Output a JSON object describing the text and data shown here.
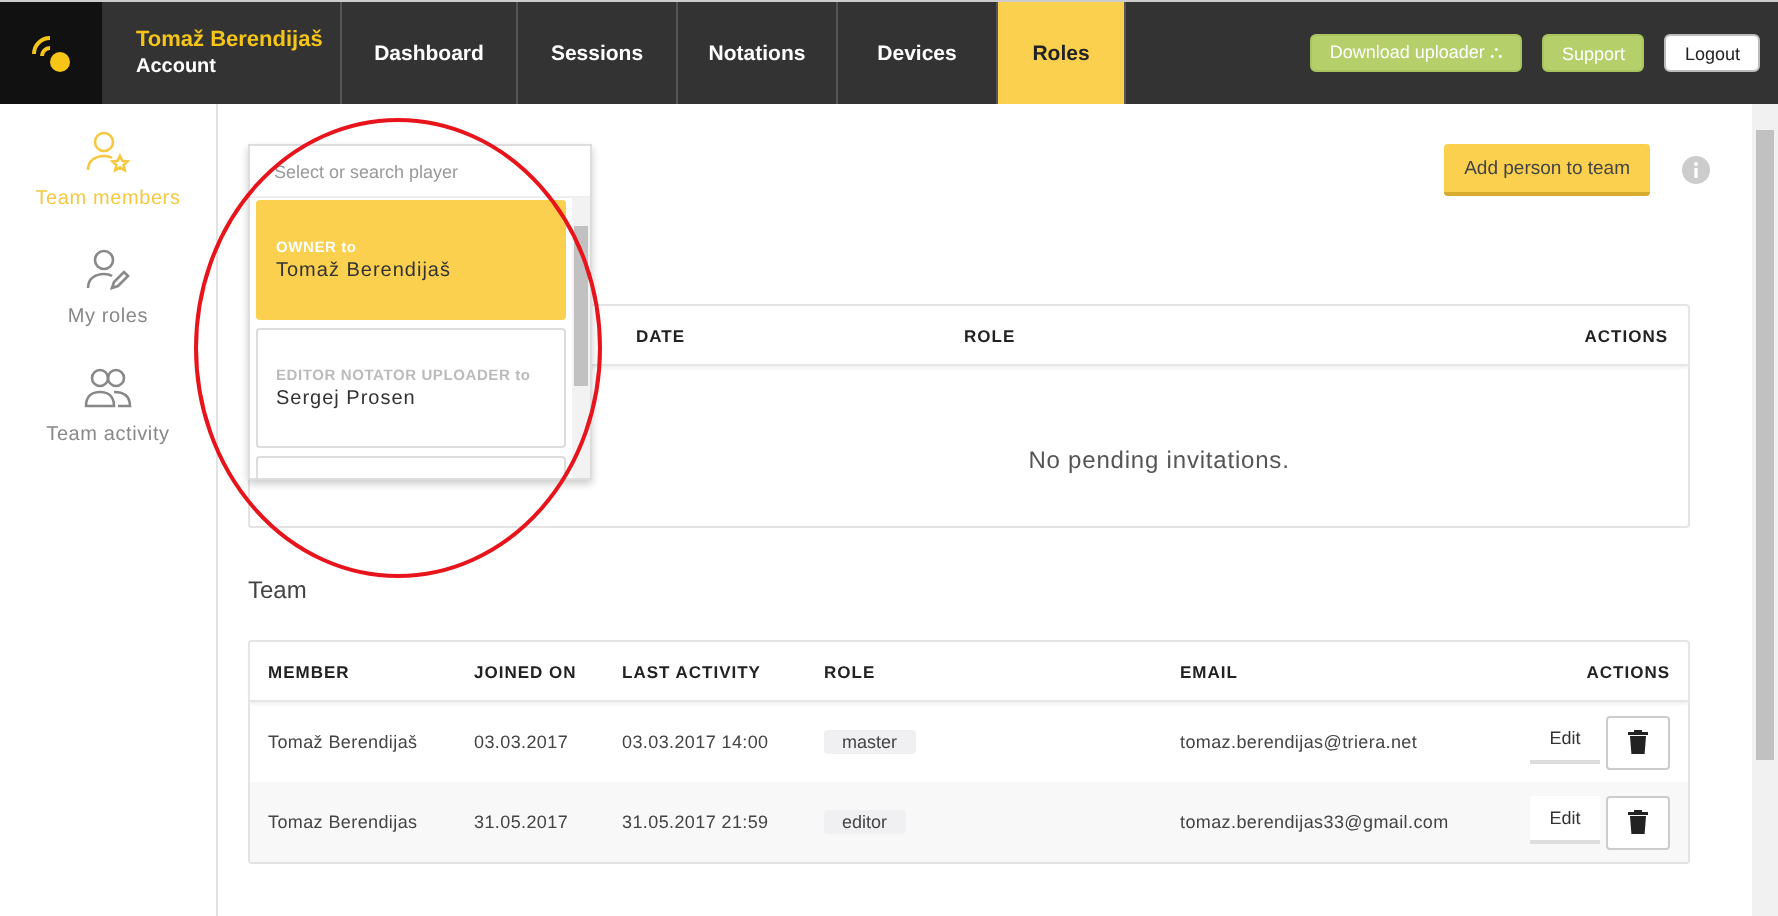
{
  "header": {
    "user_name": "Tomaž Berendijaš",
    "account_label": "Account",
    "nav": [
      {
        "label": "Dashboard",
        "selected": false
      },
      {
        "label": "Sessions",
        "selected": false
      },
      {
        "label": "Notations",
        "selected": false
      },
      {
        "label": "Devices",
        "selected": false
      },
      {
        "label": "Roles",
        "selected": true
      }
    ],
    "buttons": [
      {
        "label": "Download uploader ⛬",
        "kind": "accent"
      },
      {
        "label": "Support",
        "kind": "accent"
      },
      {
        "label": "Logout",
        "kind": "plain"
      }
    ]
  },
  "sidebar": {
    "items": [
      {
        "label": "Team members",
        "kind": "person-star",
        "selected": true
      },
      {
        "label": "My roles",
        "kind": "person-pen",
        "selected": false
      },
      {
        "label": "Team activity",
        "kind": "people",
        "selected": false
      }
    ]
  },
  "player_select": {
    "placeholder": "Select or search player",
    "options": [
      {
        "roles": "OWNER to",
        "name": "Tomaž Berendijaš",
        "selected": true
      },
      {
        "roles": "EDITOR NOTATOR UPLOADER to",
        "name": "Sergej Prosen",
        "selected": false
      }
    ]
  },
  "add_button": "Add person to team",
  "invitations": {
    "columns": [
      "DATE",
      "ROLE",
      "ACTIONS"
    ],
    "empty_text": "No pending invitations."
  },
  "team": {
    "title": "Team",
    "columns": [
      "MEMBER",
      "JOINED ON",
      "LAST ACTIVITY",
      "ROLE",
      "EMAIL",
      "ACTIONS"
    ],
    "rows": [
      {
        "member": "Tomaž Berendijaš",
        "joined": "03.03.2017",
        "last_activity": "03.03.2017 14:00",
        "roles": [
          "master"
        ],
        "email": "tomaz.berendijas@triera.net",
        "edit": "Edit"
      },
      {
        "member": "Tomaz Berendijas",
        "joined": "31.05.2017",
        "last_activity": "31.05.2017 21:59",
        "roles": [
          "editor"
        ],
        "email": "tomaz.berendijas33@gmail.com",
        "edit": "Edit"
      }
    ]
  }
}
